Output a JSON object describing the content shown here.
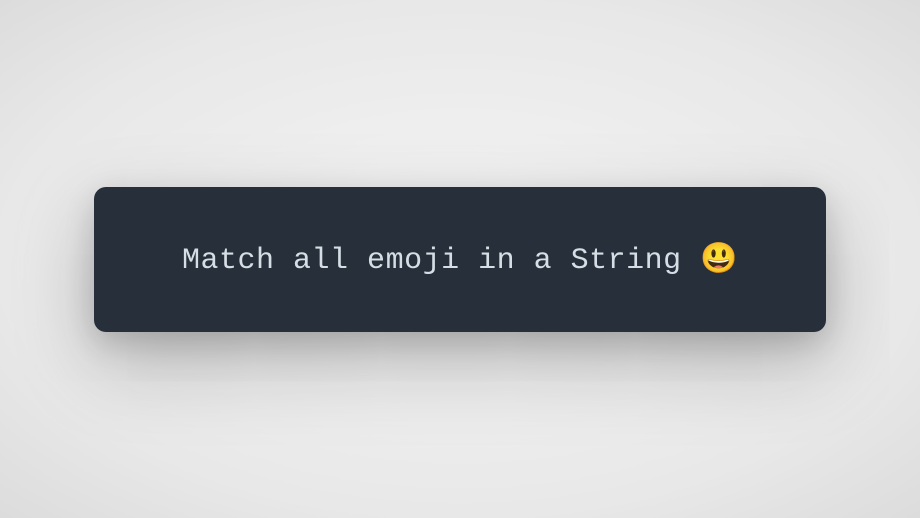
{
  "card": {
    "text": "Match all emoji in a String 😃"
  }
}
